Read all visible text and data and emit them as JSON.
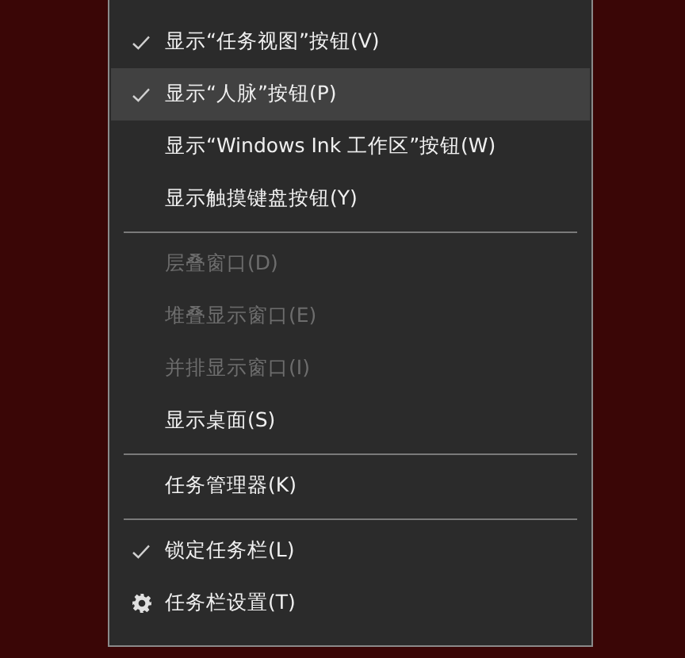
{
  "menu": {
    "items": [
      {
        "kind": "option",
        "label": "显示“任务视图”按钮(V)",
        "checked": true,
        "highlighted": false,
        "disabled": false
      },
      {
        "kind": "option",
        "label": "显示“人脉”按钮(P)",
        "checked": true,
        "highlighted": true,
        "disabled": false
      },
      {
        "kind": "option",
        "label": "显示“Windows Ink 工作区”按钮(W)",
        "checked": false,
        "highlighted": false,
        "disabled": false
      },
      {
        "kind": "option",
        "label": "显示触摸键盘按钮(Y)",
        "checked": false,
        "highlighted": false,
        "disabled": false
      },
      {
        "kind": "separator"
      },
      {
        "kind": "option",
        "label": "层叠窗口(D)",
        "checked": false,
        "highlighted": false,
        "disabled": true
      },
      {
        "kind": "option",
        "label": "堆叠显示窗口(E)",
        "checked": false,
        "highlighted": false,
        "disabled": true
      },
      {
        "kind": "option",
        "label": "并排显示窗口(I)",
        "checked": false,
        "highlighted": false,
        "disabled": true
      },
      {
        "kind": "option",
        "label": "显示桌面(S)",
        "checked": false,
        "highlighted": false,
        "disabled": false
      },
      {
        "kind": "separator"
      },
      {
        "kind": "option",
        "label": "任务管理器(K)",
        "checked": false,
        "highlighted": false,
        "disabled": false
      },
      {
        "kind": "separator"
      },
      {
        "kind": "option",
        "label": "锁定任务栏(L)",
        "checked": true,
        "highlighted": false,
        "disabled": false
      },
      {
        "kind": "settings",
        "label": "任务栏设置(T)",
        "highlighted": false,
        "disabled": false
      }
    ]
  }
}
